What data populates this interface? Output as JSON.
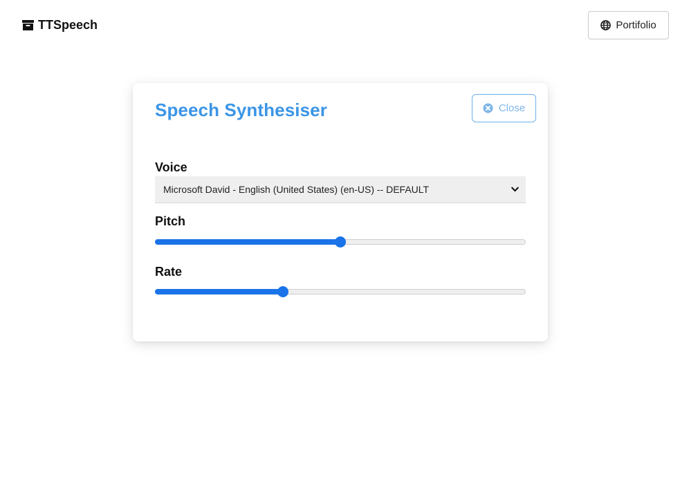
{
  "header": {
    "brand_label": "TTSpeech",
    "brand_icon": "archive-box-icon",
    "portfolio_label": "Portifolio",
    "portfolio_icon": "globe-icon"
  },
  "card": {
    "title": "Speech Synthesiser",
    "close_label": "Close",
    "close_icon": "times-circle-icon",
    "voice": {
      "label": "Voice",
      "selected": "Microsoft David - English (United States) (en-US) -- DEFAULT"
    },
    "pitch": {
      "label": "Pitch",
      "value_fraction": 0.5
    },
    "rate": {
      "label": "Rate",
      "value_fraction": 0.34
    }
  },
  "colors": {
    "accent": "#3b95e6",
    "slider": "#1a73e8",
    "close_border": "#6aaeea"
  }
}
